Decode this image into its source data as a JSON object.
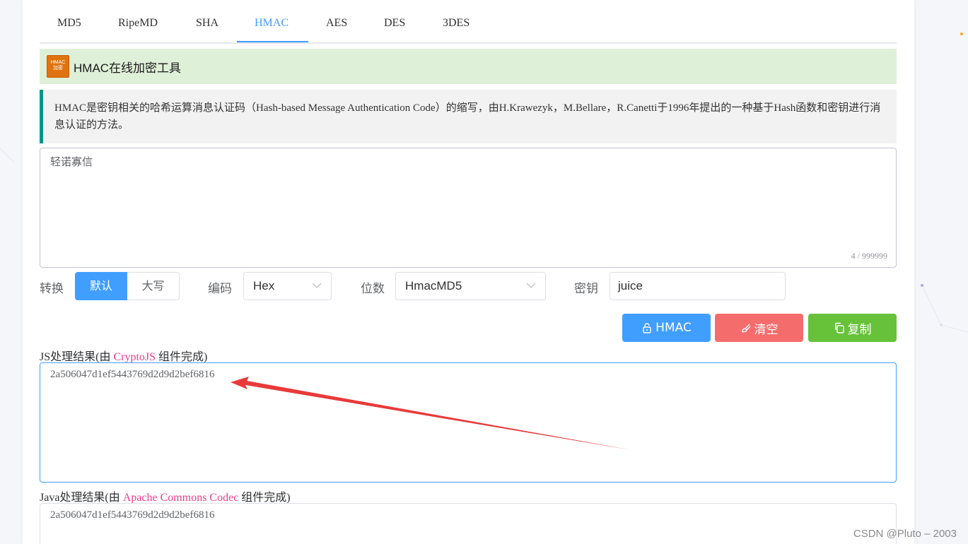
{
  "tabs": [
    {
      "label": "MD5"
    },
    {
      "label": "RipeMD"
    },
    {
      "label": "SHA"
    },
    {
      "label": "HMAC",
      "active": true
    },
    {
      "label": "AES"
    },
    {
      "label": "DES"
    },
    {
      "label": "3DES"
    }
  ],
  "header": {
    "logo_text_top": "HMAC",
    "logo_text_bottom": "加密",
    "title": "HMAC在线加密工具"
  },
  "description": "HMAC是密钥相关的哈希运算消息认证码（Hash-based Message Authentication Code）的缩写，由H.Krawezyk，M.Bellare，R.Canetti于1996年提出的一种基于Hash函数和密钥进行消息认证的方法。",
  "input": {
    "value": "轻诺寡信",
    "count": "4 / 999999"
  },
  "options": {
    "convert_label": "转换",
    "convert_default": "默认",
    "convert_upper": "大写",
    "encoding_label": "编码",
    "encoding_value": "Hex",
    "bits_label": "位数",
    "bits_value": "HmacMD5",
    "key_label": "密钥",
    "key_value": "juice"
  },
  "actions": {
    "hmac": "HMAC",
    "clear": "清空",
    "copy": "复制"
  },
  "results": {
    "js_prefix": "JS处理结果(由 ",
    "js_lib": "CryptoJS",
    "js_suffix": " 组件完成)",
    "js_value": "2a506047d1ef5443769d2d9d2bef6816",
    "java_prefix": "Java处理结果(由 ",
    "java_lib": "Apache Commons Codec",
    "java_suffix": " 组件完成)",
    "java_value": "2a506047d1ef5443769d2d9d2bef6816"
  },
  "watermark": "CSDN @Pluto – 2003",
  "colors": {
    "primary": "#409eff",
    "danger": "#f56c6c",
    "success": "#67c23a",
    "accent_pink": "#e83e8c",
    "title_bg": "#dff0d8",
    "desc_border": "#009688",
    "annotation_arrow": "#e83a3a"
  }
}
